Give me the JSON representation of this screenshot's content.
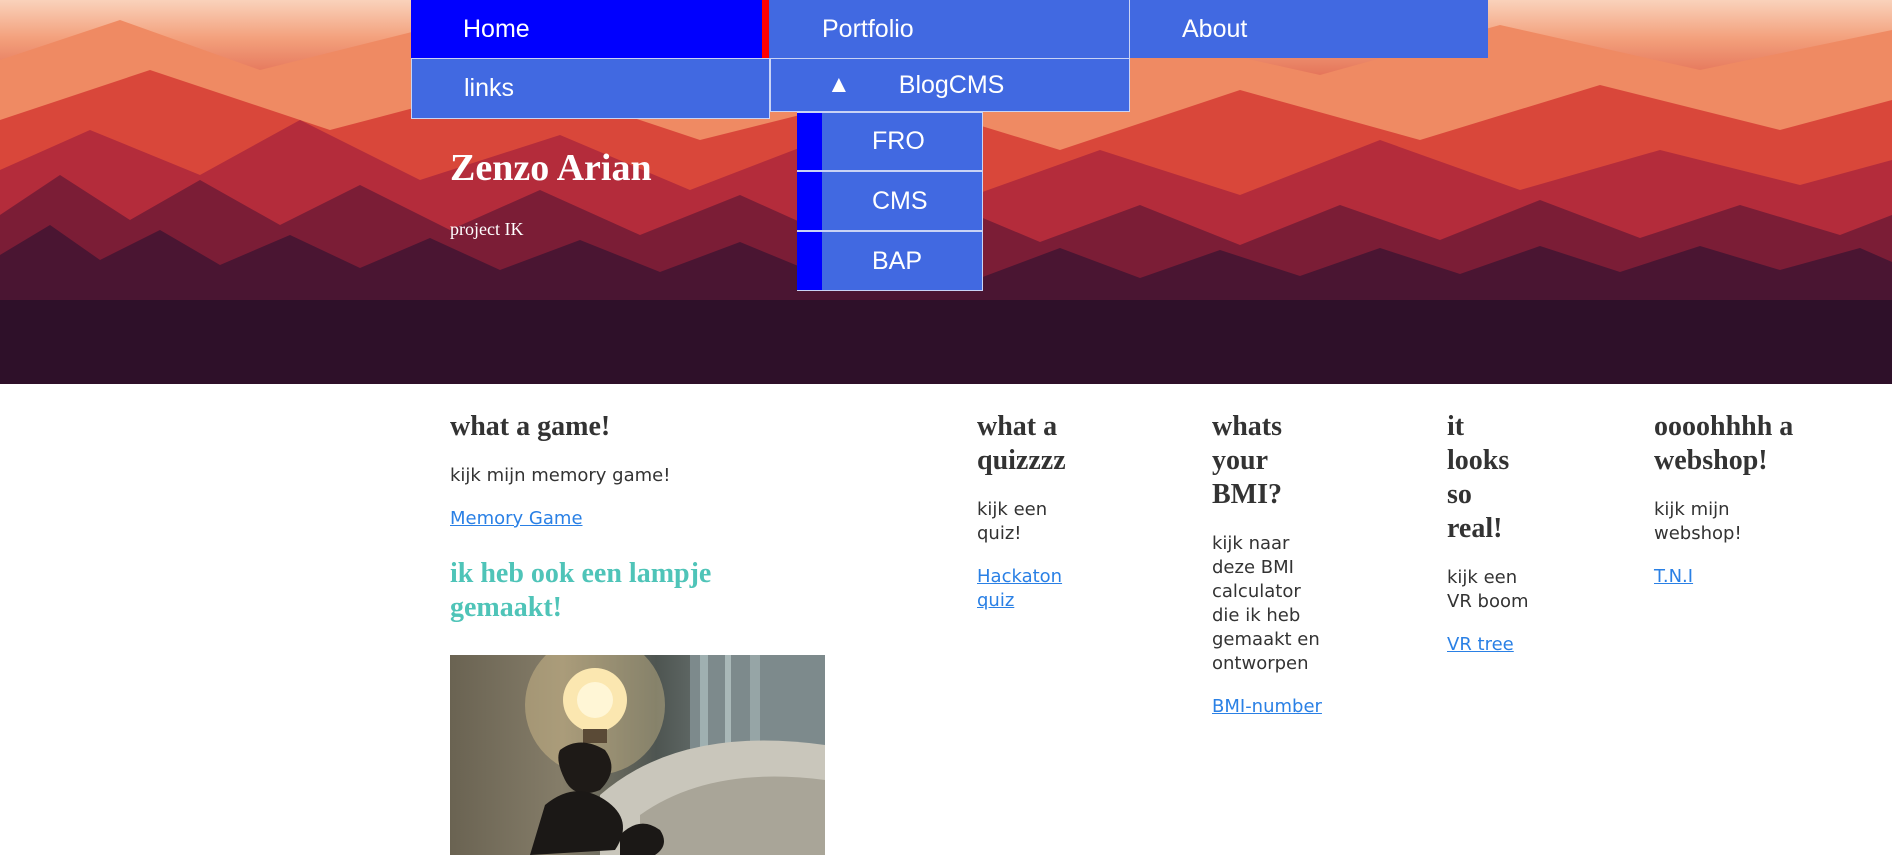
{
  "nav": {
    "home": "Home",
    "portfolio": "Portfolio",
    "about": "About",
    "links": "links",
    "blogcms_arrow": "▲",
    "blogcms": "BlogCMS",
    "submenu": [
      "FRO",
      "CMS",
      "BAP"
    ]
  },
  "hero": {
    "title": "Zenzo Arian",
    "subtitle": "project IK"
  },
  "sections": {
    "game": {
      "heading": "what a game!",
      "text": "kijk mijn memory game!",
      "link": "Memory Game",
      "lamp_heading": "ik heb ook een lampje gemaakt!"
    },
    "quiz": {
      "heading": "what a quizzzz",
      "text": "kijk een quiz!",
      "link": "Hackaton quiz"
    },
    "bmi": {
      "heading": "whats your BMI?",
      "text": "kijk naar deze BMI calculator die ik heb gemaakt en ontworpen",
      "link": "BMI-number"
    },
    "vr": {
      "heading": "it looks so real!",
      "text": "kijk een VR boom",
      "link": "VR tree"
    },
    "shop": {
      "heading": "oooohhhh a webshop!",
      "text": "kijk mijn webshop!",
      "link": "T.N.I"
    }
  },
  "colors": {
    "nav_blue": "#4169e1",
    "active_blue": "#0000ff",
    "active_marker": "#ff0000",
    "link": "#2a80e5",
    "lamp_heading": "#4fc4b8"
  }
}
